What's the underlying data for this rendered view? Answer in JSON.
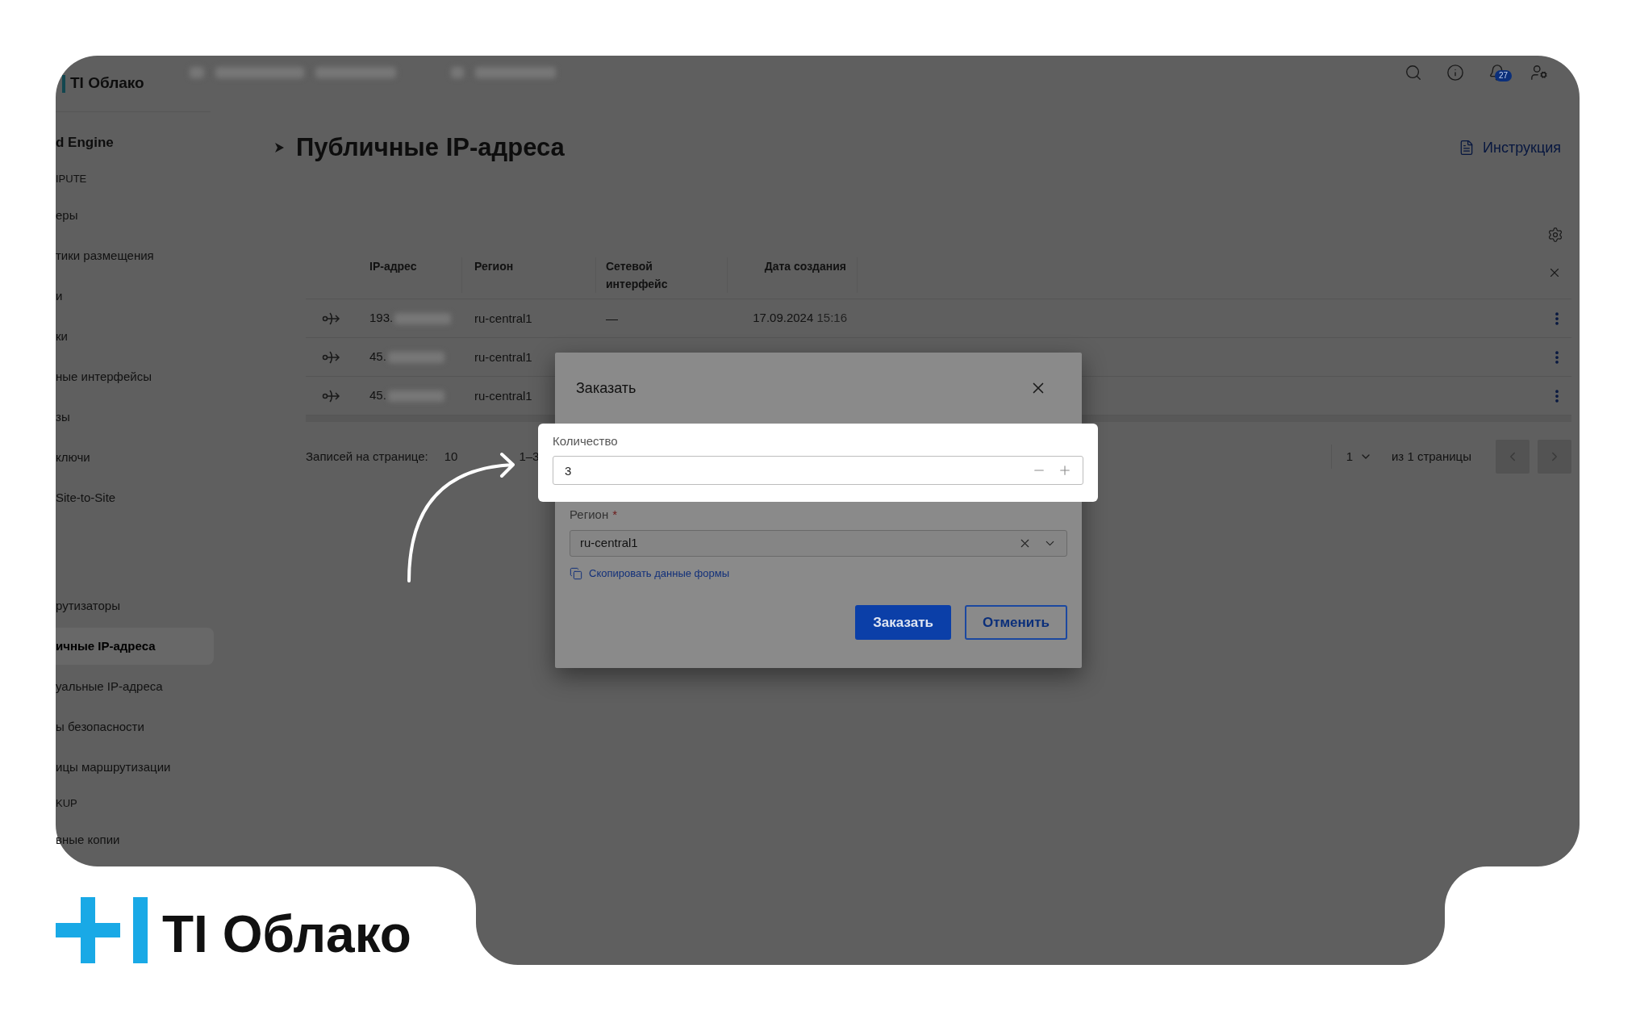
{
  "app_logo": {
    "text": "TI Облако"
  },
  "header": {
    "notifications_badge": "27"
  },
  "sidebar": {
    "title": "d Engine",
    "groups": [
      {
        "heading": "IPUTE",
        "items": [
          {
            "label": "еры",
            "selected": false
          },
          {
            "label": "тики размещения",
            "selected": false
          },
          {
            "label": "и",
            "selected": false
          },
          {
            "label": "ки",
            "selected": false
          },
          {
            "label": "ные интерфейсы",
            "selected": false
          },
          {
            "label": "зы",
            "selected": false
          },
          {
            "label": "ключи",
            "selected": false
          },
          {
            "label": "Site-to-Site",
            "selected": false
          }
        ]
      },
      {
        "items": [
          {
            "label": "рутизаторы",
            "selected": false
          },
          {
            "label": "ичные IP-адреса",
            "selected": true
          },
          {
            "label": "уальные IP-адреса",
            "selected": false
          },
          {
            "label": "ы безопасности",
            "selected": false
          },
          {
            "label": "ицы маршрутизации",
            "selected": false
          }
        ]
      },
      {
        "heading": "KUP",
        "items": [
          {
            "label": "вные копии",
            "selected": false
          }
        ]
      }
    ]
  },
  "page": {
    "title": "Публичные IP-адреса",
    "help_link": "Инструкция"
  },
  "table": {
    "columns": [
      "IP-адрес",
      "Регион",
      "Сетевой интерфейс",
      "Дата создания"
    ],
    "rows": [
      {
        "ip": "193.",
        "region": "ru-central1",
        "interface": "—",
        "created": "17.09.2024",
        "created_time": "15:16"
      },
      {
        "ip": "45.",
        "region": "ru-central1"
      },
      {
        "ip": "45.",
        "region": "ru-central1"
      }
    ]
  },
  "pagination": {
    "label": "Записей на странице:",
    "page_size": "10",
    "range": "1–3",
    "page": "1",
    "total": "из 1 страницы"
  },
  "dialog": {
    "title": "Заказать",
    "quantity": {
      "label": "Количество",
      "value": "3"
    },
    "region": {
      "label": "Регион",
      "required_mark": "*",
      "value": "ru-central1"
    },
    "copy_link": "Скопировать данные формы",
    "buttons": [
      {
        "label": "Заказать",
        "kind": "primary"
      },
      {
        "label": "Отменить",
        "kind": "secondary"
      }
    ]
  },
  "brand": {
    "text": "TI Облако"
  }
}
